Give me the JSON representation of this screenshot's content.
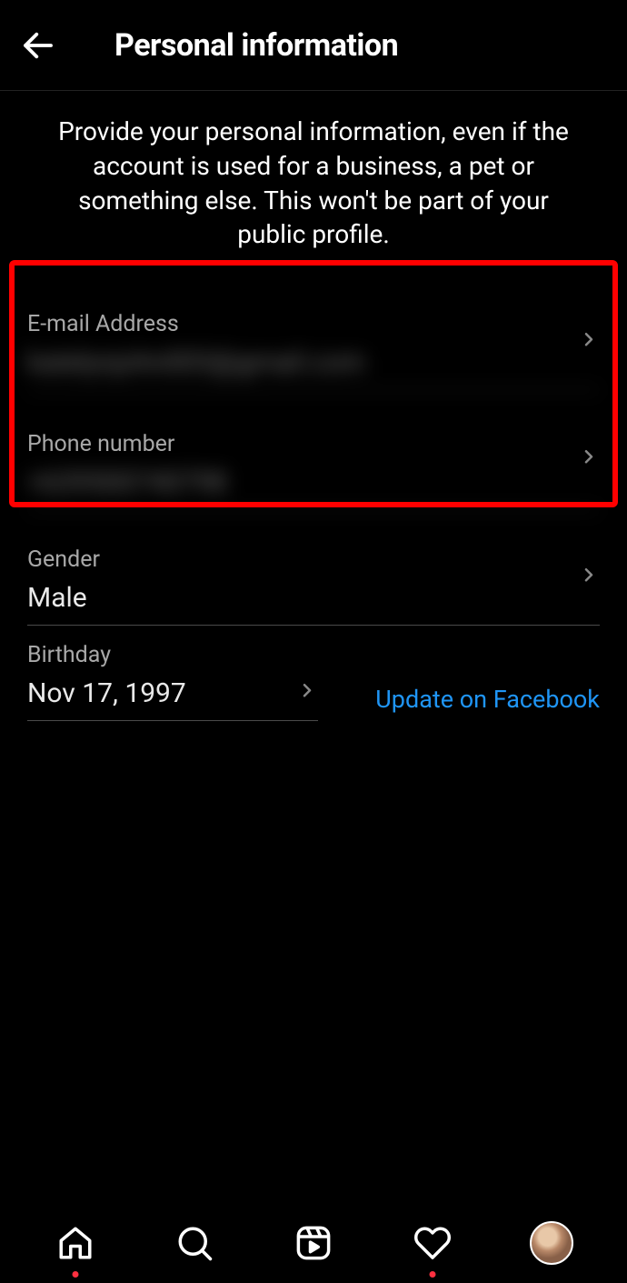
{
  "header": {
    "title": "Personal information"
  },
  "description": "Provide your personal information, even if the account is used for a business, a pet or something else. This won't be part of your public profile.",
  "fields": {
    "email": {
      "label": "E-mail Address",
      "value": "katelynjohn003@gmail.com"
    },
    "phone": {
      "label": "Phone number",
      "value": "+639500740798"
    },
    "gender": {
      "label": "Gender",
      "value": "Male"
    },
    "birthday": {
      "label": "Birthday",
      "value": "Nov 17, 1997"
    }
  },
  "facebookLink": "Update on Facebook",
  "nav": {
    "home": "home-icon",
    "search": "search-icon",
    "reels": "reels-icon",
    "activity": "heart-icon",
    "profile": "profile-avatar"
  }
}
